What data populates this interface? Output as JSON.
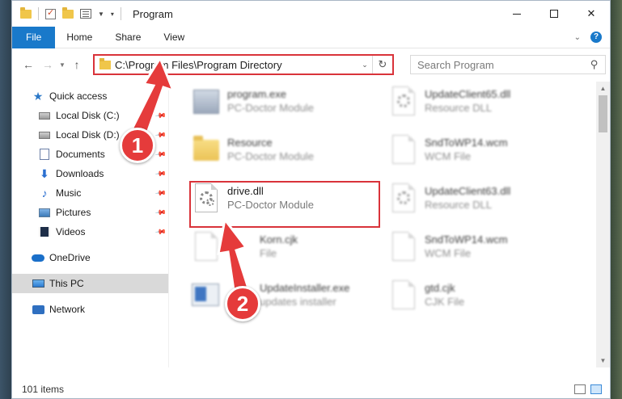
{
  "window": {
    "title": "Program",
    "controls": {
      "minimize": "",
      "maximize": "",
      "close": "✕"
    }
  },
  "ribbon": {
    "tabs": [
      {
        "label": "File",
        "active": true
      },
      {
        "label": "Home"
      },
      {
        "label": "Share"
      },
      {
        "label": "View"
      }
    ],
    "help": "?"
  },
  "nav": {
    "back": "←",
    "forward": "→",
    "up": "↑",
    "address": "C:\\Program Files\\Program Directory",
    "search_placeholder": "Search Program"
  },
  "sidebar": {
    "items": [
      {
        "label": "Quick access",
        "icon": "star-icon",
        "pinned": false
      },
      {
        "label": "Local Disk (C:)",
        "icon": "disk-icon",
        "pinned": true
      },
      {
        "label": "Local Disk (D:)",
        "icon": "disk-icon",
        "pinned": true
      },
      {
        "label": "Documents",
        "icon": "documents-icon",
        "pinned": true
      },
      {
        "label": "Downloads",
        "icon": "download-icon",
        "pinned": true
      },
      {
        "label": "Music",
        "icon": "music-icon",
        "pinned": true
      },
      {
        "label": "Pictures",
        "icon": "pictures-icon",
        "pinned": true
      },
      {
        "label": "Videos",
        "icon": "videos-icon",
        "pinned": true
      },
      {
        "label": "OneDrive",
        "icon": "cloud-icon"
      },
      {
        "label": "This PC",
        "icon": "pc-icon",
        "selected": true
      },
      {
        "label": "Network",
        "icon": "network-icon"
      }
    ]
  },
  "files": [
    {
      "name": "program.exe",
      "type": "PC-Doctor Module",
      "icon": "exe-icon",
      "blurred": true
    },
    {
      "name": "UpdateClient65.dll",
      "type": "Resource DLL",
      "icon": "dll-icon",
      "blurred": true
    },
    {
      "name": "Resource",
      "type": "PC-Doctor Module",
      "icon": "folder-icon",
      "blurred": true
    },
    {
      "name": "SndToWP14.wcm",
      "type": "WCM File",
      "icon": "file-icon",
      "blurred": true
    },
    {
      "name": "drive.dll",
      "type": "PC-Doctor Module",
      "icon": "dll-icon",
      "blurred": false
    },
    {
      "name": "UpdateClient63.dll",
      "type": "Resource DLL",
      "icon": "dll-icon",
      "blurred": true
    },
    {
      "name": "Korn.cjk",
      "type": "File",
      "icon": "file-icon",
      "blurred": true
    },
    {
      "name": "SndToWP14.wcm",
      "type": "WCM File",
      "icon": "file-icon",
      "blurred": true
    },
    {
      "name": "UpdateInstaller.exe",
      "type": "updates installer",
      "icon": "installer-icon",
      "blurred": true
    },
    {
      "name": "gtd.cjk",
      "type": "CJK File",
      "icon": "file-icon",
      "blurred": true
    }
  ],
  "status": {
    "count": "101 items"
  },
  "annotations": {
    "step1": "1",
    "step2": "2",
    "color": "#e53b3b"
  }
}
